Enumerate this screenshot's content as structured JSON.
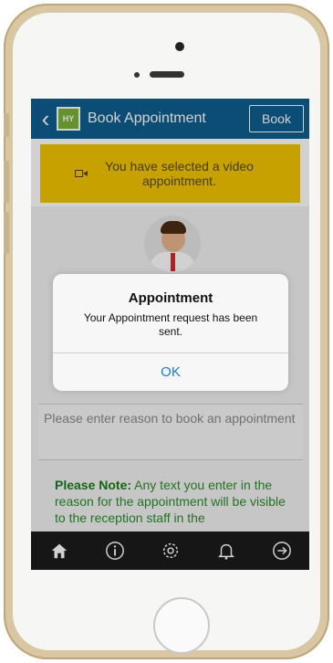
{
  "navbar": {
    "title": "Book Appointment",
    "logo_text": "HY",
    "book_label": "Book"
  },
  "banner": {
    "text": "You have selected a video appointment."
  },
  "form": {
    "reason_placeholder": "Please enter reason to book an appointment",
    "note_label": "Please Note:",
    "note_text": "Any text you enter in the reason for the appointment will be visible to the reception staff in the"
  },
  "alert": {
    "title": "Appointment",
    "message": "Your Appointment request has been sent.",
    "ok_label": "OK"
  },
  "tabbar": {
    "items": [
      "home-icon",
      "info-icon",
      "settings-icon",
      "notifications-icon",
      "logout-icon"
    ]
  },
  "colors": {
    "navbar": "#0f5e90",
    "banner": "#f2c500",
    "note": "#2c8c2c",
    "alert_button": "#1f7ae0"
  }
}
